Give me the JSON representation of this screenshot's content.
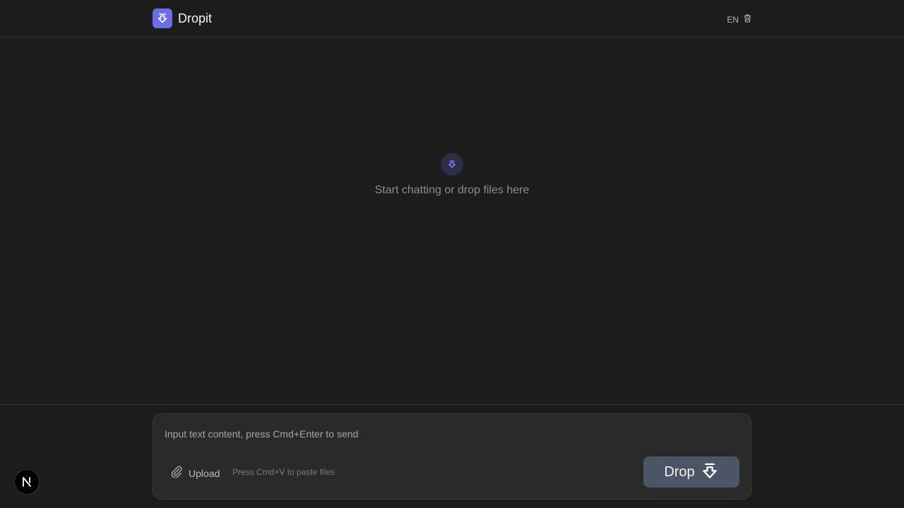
{
  "app": {
    "name": "Dropit",
    "logo_icon": "drop-arrow-icon",
    "accent": "#6b6ee8"
  },
  "header": {
    "language": "EN",
    "trash_icon": "trash-icon"
  },
  "empty_state": {
    "icon": "drop-arrow-icon",
    "message": "Start chatting or drop files here"
  },
  "composer": {
    "placeholder": "Input text content, press Cmd+Enter to send",
    "value": "",
    "upload_label": "Upload",
    "upload_icon": "paperclip-icon",
    "paste_hint": "Press Cmd+V to paste files",
    "send_label": "Drop",
    "send_icon": "drop-arrow-icon",
    "send_color": "#4b5566"
  },
  "dev_badge": {
    "label": "N"
  }
}
